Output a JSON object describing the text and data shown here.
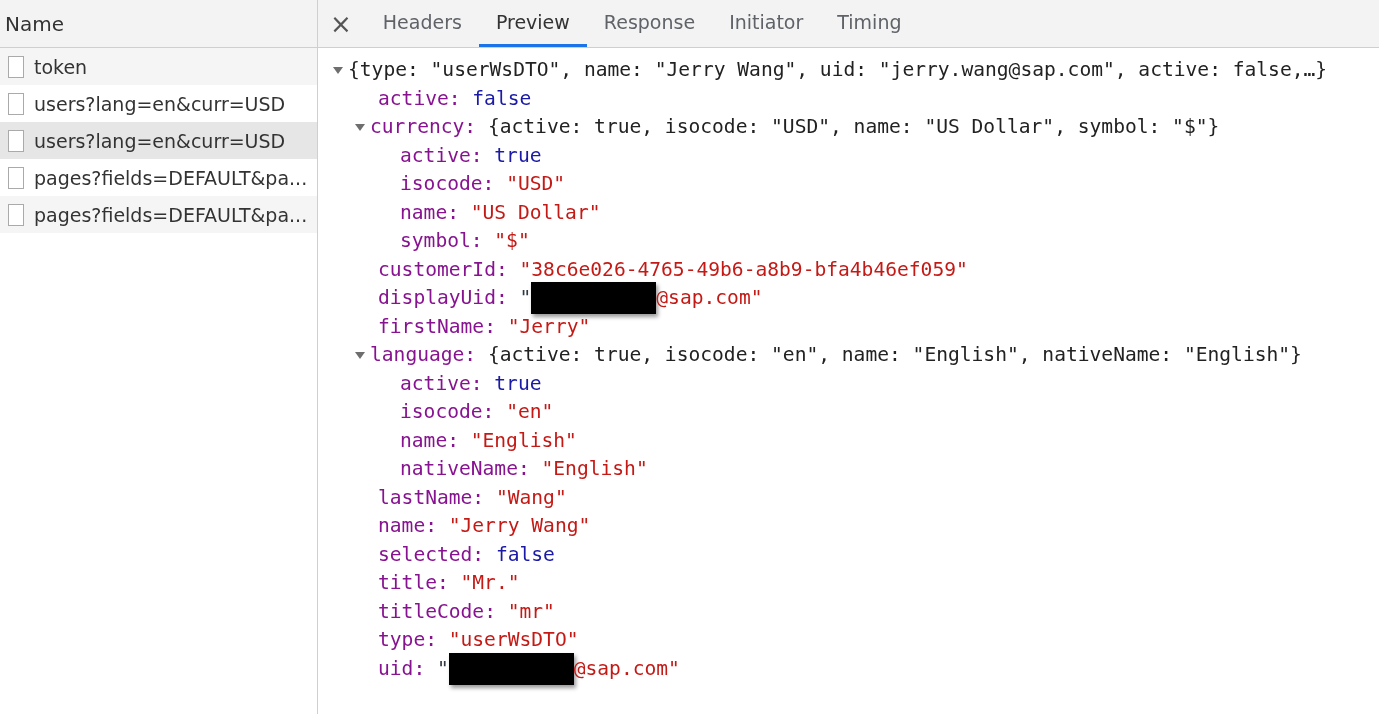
{
  "requests": {
    "header": "Name",
    "items": [
      {
        "name": "token",
        "selected": false
      },
      {
        "name": "users?lang=en&curr=USD",
        "selected": false
      },
      {
        "name": "users?lang=en&curr=USD",
        "selected": true
      },
      {
        "name": "pages?fields=DEFAULT&pa...",
        "selected": false
      },
      {
        "name": "pages?fields=DEFAULT&pa...",
        "selected": false
      }
    ]
  },
  "close_icon": "×",
  "tabs": [
    {
      "label": "Headers",
      "selected": false
    },
    {
      "label": "Preview",
      "selected": true
    },
    {
      "label": "Response",
      "selected": false
    },
    {
      "label": "Initiator",
      "selected": false
    },
    {
      "label": "Timing",
      "selected": false
    }
  ],
  "preview": {
    "kind": "object",
    "expanded": true,
    "summary": "{type: \"userWsDTO\", name: \"Jerry Wang\", uid: \"jerry.wang@sap.com\", active: false,…}",
    "children": [
      {
        "kind": "bool",
        "key": "active:",
        "value": "false"
      },
      {
        "kind": "object",
        "key": "currency:",
        "expanded": true,
        "summary": "{active: true, isocode: \"USD\", name: \"US Dollar\", symbol: \"$\"}",
        "children": [
          {
            "kind": "bool",
            "key": "active:",
            "value": "true"
          },
          {
            "kind": "string",
            "key": "isocode:",
            "value": "\"USD\""
          },
          {
            "kind": "string",
            "key": "name:",
            "value": "\"US Dollar\""
          },
          {
            "kind": "string",
            "key": "symbol:",
            "value": "\"$\""
          }
        ]
      },
      {
        "kind": "string",
        "key": "customerId:",
        "value": "\"38c6e026-4765-49b6-a8b9-bfa4b46ef059\""
      },
      {
        "kind": "redacted",
        "key": "displayUid:",
        "before": "\"",
        "value": "@sap.com\""
      },
      {
        "kind": "string",
        "key": "firstName:",
        "value": "\"Jerry\""
      },
      {
        "kind": "object",
        "key": "language:",
        "expanded": true,
        "summary": "{active: true, isocode: \"en\", name: \"English\", nativeName: \"English\"}",
        "children": [
          {
            "kind": "bool",
            "key": "active:",
            "value": "true"
          },
          {
            "kind": "string",
            "key": "isocode:",
            "value": "\"en\""
          },
          {
            "kind": "string",
            "key": "name:",
            "value": "\"English\""
          },
          {
            "kind": "string",
            "key": "nativeName:",
            "value": "\"English\""
          }
        ]
      },
      {
        "kind": "string",
        "key": "lastName:",
        "value": "\"Wang\""
      },
      {
        "kind": "string",
        "key": "name:",
        "value": "\"Jerry Wang\""
      },
      {
        "kind": "bool",
        "key": "selected:",
        "value": "false"
      },
      {
        "kind": "string",
        "key": "title:",
        "value": "\"Mr.\""
      },
      {
        "kind": "string",
        "key": "titleCode:",
        "value": "\"mr\""
      },
      {
        "kind": "string",
        "key": "type:",
        "value": "\"userWsDTO\""
      },
      {
        "kind": "redacted",
        "key": "uid:",
        "before": "\"",
        "value": "@sap.com\""
      }
    ]
  }
}
